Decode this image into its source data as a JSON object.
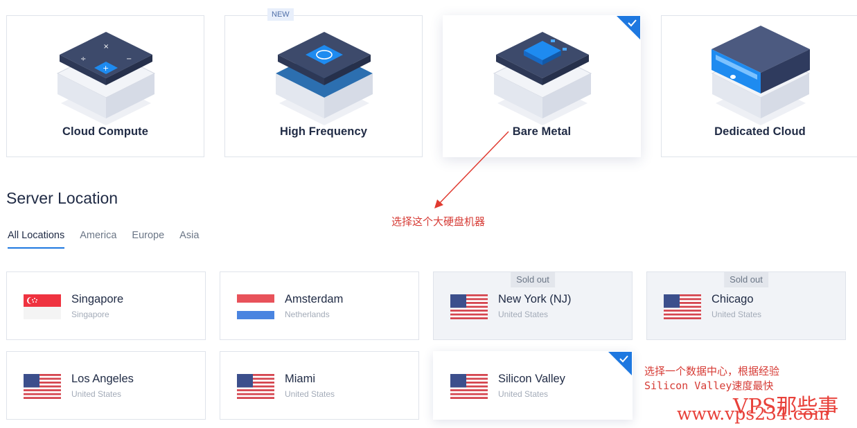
{
  "server_types": [
    {
      "label": "Cloud Compute",
      "selected": false,
      "badge": ""
    },
    {
      "label": "High Frequency",
      "selected": false,
      "badge": "NEW"
    },
    {
      "label": "Bare Metal",
      "selected": true,
      "badge": ""
    },
    {
      "label": "Dedicated Cloud",
      "selected": false,
      "badge": ""
    }
  ],
  "location_section": {
    "title": "Server Location",
    "tabs": [
      "All Locations",
      "America",
      "Europe",
      "Asia"
    ],
    "active_tab": "All Locations"
  },
  "locations": [
    {
      "name": "Singapore",
      "sub": "Singapore",
      "flag": "singapore-flag",
      "status": ""
    },
    {
      "name": "Amsterdam",
      "sub": "Netherlands",
      "flag": "netherlands-flag",
      "status": ""
    },
    {
      "name": "New York (NJ)",
      "sub": "United States",
      "flag": "us-flag",
      "status": "Sold out"
    },
    {
      "name": "Chicago",
      "sub": "United States",
      "flag": "us-flag",
      "status": "Sold out"
    },
    {
      "name": "Los Angeles",
      "sub": "United States",
      "flag": "us-flag",
      "status": ""
    },
    {
      "name": "Miami",
      "sub": "United States",
      "flag": "us-flag",
      "status": ""
    },
    {
      "name": "Silicon Valley",
      "sub": "United States",
      "flag": "us-flag",
      "status": "selected"
    }
  ],
  "annotations": {
    "bare_metal_note": "选择这个大硬盘机器",
    "location_note_line1": "选择一个数据中心，根据经验",
    "location_note_line2": "Silicon Valley速度最快",
    "watermark_title": "VPS那些事",
    "watermark_url": "www.vps234.com"
  },
  "colors": {
    "accent": "#1e78e0",
    "annotation": "#d63b35",
    "text": "#1f2a44"
  }
}
